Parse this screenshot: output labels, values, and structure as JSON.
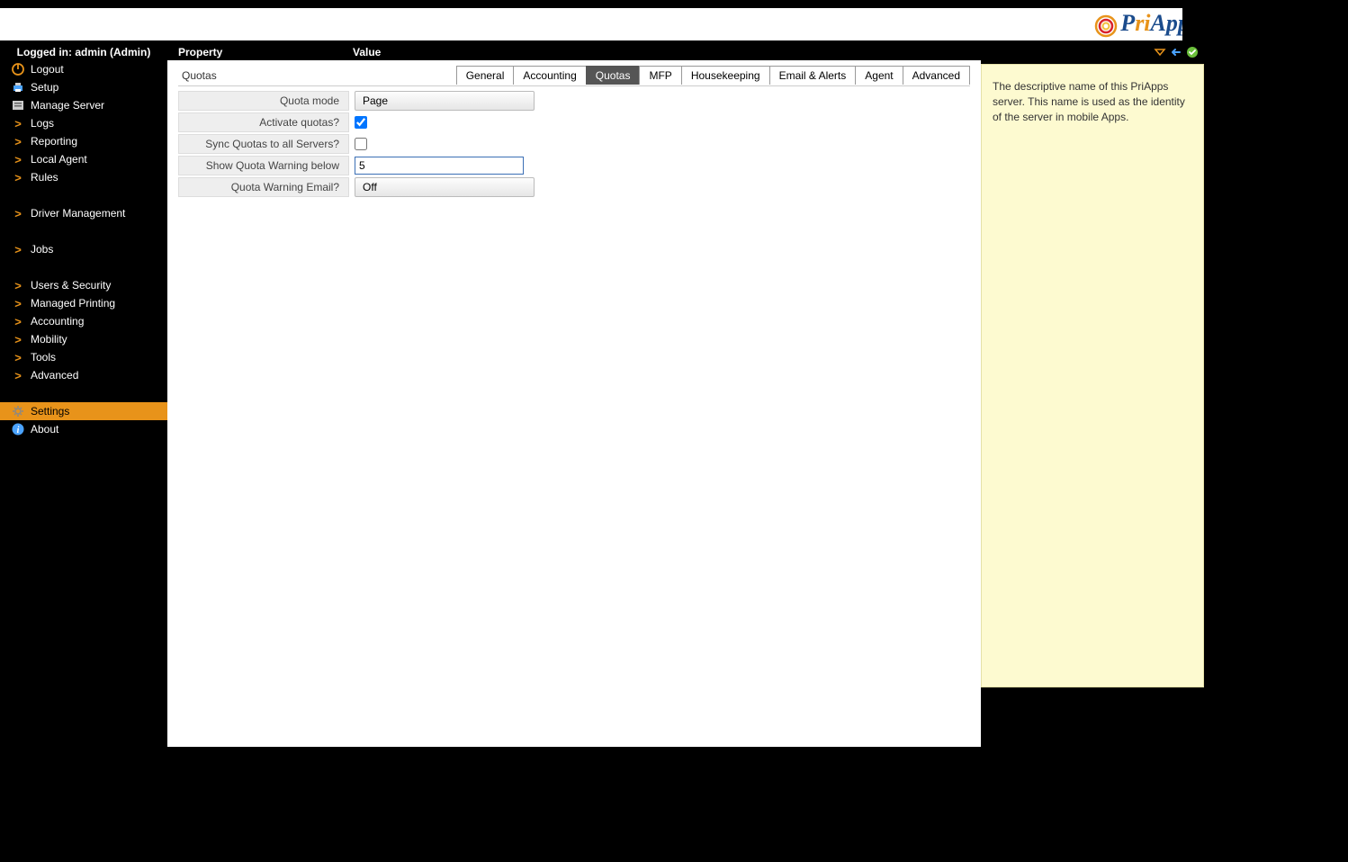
{
  "brand": {
    "name_part1": "Pri",
    "name_part2": "Apps"
  },
  "header": {
    "logged_in_label": "Logged in: admin (Admin)",
    "property_label": "Property",
    "value_label": "Value"
  },
  "sidebar": {
    "items": [
      {
        "key": "logout",
        "label": "Logout",
        "icon": "power-icon"
      },
      {
        "key": "setup",
        "label": "Setup",
        "icon": "printer-icon"
      },
      {
        "key": "manage-server",
        "label": "Manage Server",
        "icon": "server-icon"
      },
      {
        "key": "logs",
        "label": "Logs",
        "icon": "chevron-icon"
      },
      {
        "key": "reporting",
        "label": "Reporting",
        "icon": "chevron-icon"
      },
      {
        "key": "local-agent",
        "label": "Local Agent",
        "icon": "chevron-icon"
      },
      {
        "key": "rules",
        "label": "Rules",
        "icon": "chevron-icon"
      },
      {
        "key": "spacer1",
        "spacer": true
      },
      {
        "key": "driver-management",
        "label": "Driver Management",
        "icon": "chevron-icon"
      },
      {
        "key": "spacer2",
        "spacer": true
      },
      {
        "key": "jobs",
        "label": "Jobs",
        "icon": "chevron-icon"
      },
      {
        "key": "spacer3",
        "spacer": true
      },
      {
        "key": "users-security",
        "label": "Users & Security",
        "icon": "chevron-icon"
      },
      {
        "key": "managed-printing",
        "label": "Managed Printing",
        "icon": "chevron-icon"
      },
      {
        "key": "accounting",
        "label": "Accounting",
        "icon": "chevron-icon"
      },
      {
        "key": "mobility",
        "label": "Mobility",
        "icon": "chevron-icon"
      },
      {
        "key": "tools",
        "label": "Tools",
        "icon": "chevron-icon"
      },
      {
        "key": "advanced",
        "label": "Advanced",
        "icon": "chevron-icon"
      },
      {
        "key": "spacer4",
        "spacer": true
      },
      {
        "key": "settings",
        "label": "Settings",
        "icon": "gear-icon",
        "active": true
      },
      {
        "key": "about",
        "label": "About",
        "icon": "info-icon"
      }
    ]
  },
  "main": {
    "section_title": "Quotas",
    "tabs": [
      {
        "label": "General"
      },
      {
        "label": "Accounting"
      },
      {
        "label": "Quotas",
        "active": true
      },
      {
        "label": "MFP"
      },
      {
        "label": "Housekeeping"
      },
      {
        "label": "Email & Alerts"
      },
      {
        "label": "Agent"
      },
      {
        "label": "Advanced"
      }
    ],
    "rows": [
      {
        "label": "Quota mode",
        "type": "select",
        "value": "Page"
      },
      {
        "label": "Activate quotas?",
        "type": "checkbox",
        "checked": true
      },
      {
        "label": "Sync Quotas to all Servers?",
        "type": "checkbox",
        "checked": false
      },
      {
        "label": "Show Quota Warning below",
        "type": "text",
        "value": "5"
      },
      {
        "label": "Quota Warning Email?",
        "type": "select",
        "value": "Off"
      }
    ]
  },
  "help": {
    "text": "The descriptive name of this PriApps server. This name is used as the identity of the server in mobile Apps."
  },
  "toolbar_icons": {
    "triangle": "▽",
    "back": "←",
    "ok": "✓"
  }
}
